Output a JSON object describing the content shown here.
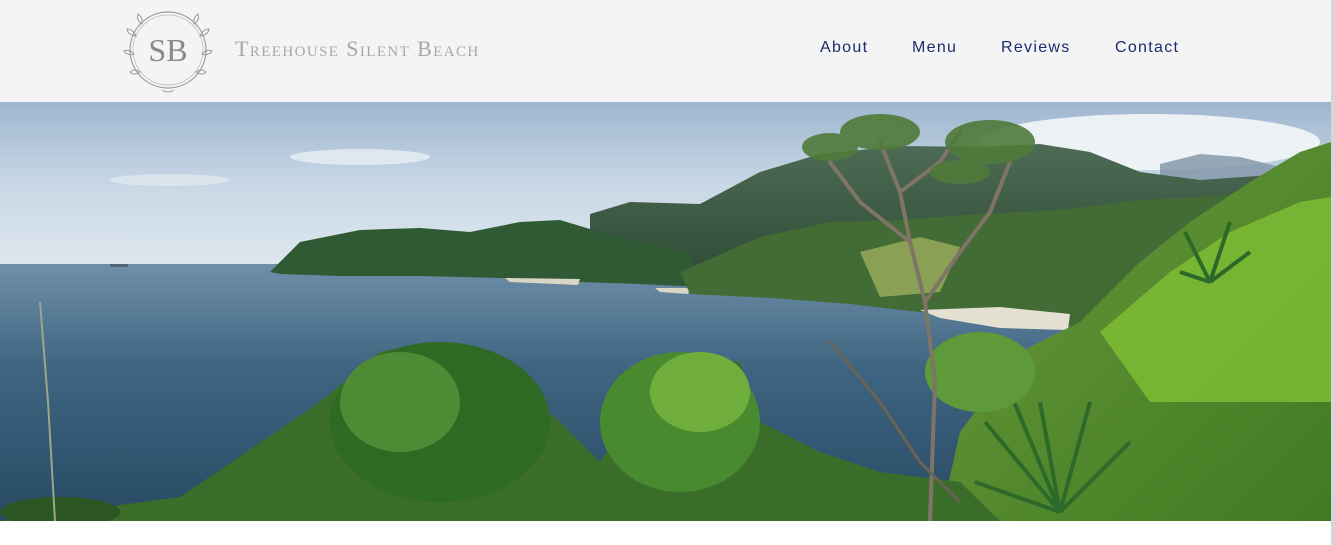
{
  "header": {
    "logo_monogram": "SB",
    "brand": "Treehouse Silent Beach"
  },
  "nav": {
    "items": [
      {
        "label": "About"
      },
      {
        "label": "Menu"
      },
      {
        "label": "Reviews"
      },
      {
        "label": "Contact"
      }
    ]
  },
  "colors": {
    "header_bg": "#f4f4f4",
    "nav_text": "#1e2a6e",
    "brand_text": "#a8a8a8"
  },
  "icons": {
    "logo": "wreath-monogram-logo"
  }
}
